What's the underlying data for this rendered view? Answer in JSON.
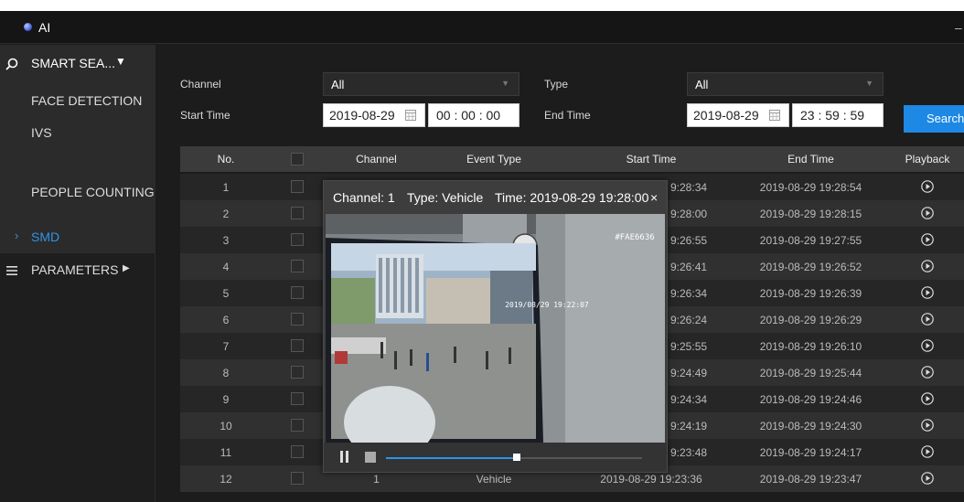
{
  "app": {
    "title": "AI",
    "minimize": "–"
  },
  "sidebar": {
    "smart_search": "SMART SEA...",
    "face_detection": "FACE DETECTION",
    "ivs": "IVS",
    "people_counting": "PEOPLE COUNTING",
    "smd": "SMD",
    "parameters": "PARAMETERS"
  },
  "filters": {
    "channel_label": "Channel",
    "channel_value": "All",
    "type_label": "Type",
    "type_value": "All",
    "start_label": "Start Time",
    "start_date": "2019-08-29",
    "start_time": "00 : 00 : 00",
    "end_label": "End Time",
    "end_date": "2019-08-29",
    "end_time": "23 : 59 : 59",
    "search_label": "Search"
  },
  "table": {
    "headers": {
      "no": "No.",
      "channel": "Channel",
      "event_type": "Event Type",
      "start": "Start Time",
      "end": "End Time",
      "playback": "Playback"
    },
    "rows": [
      {
        "no": "1",
        "start": "9:28:34",
        "end": "2019-08-29 19:28:54"
      },
      {
        "no": "2",
        "start": "9:28:00",
        "end": "2019-08-29 19:28:15"
      },
      {
        "no": "3",
        "start": "9:26:55",
        "end": "2019-08-29 19:27:55"
      },
      {
        "no": "4",
        "start": "9:26:41",
        "end": "2019-08-29 19:26:52"
      },
      {
        "no": "5",
        "start": "9:26:34",
        "end": "2019-08-29 19:26:39"
      },
      {
        "no": "6",
        "start": "9:26:24",
        "end": "2019-08-29 19:26:29"
      },
      {
        "no": "7",
        "start": "9:25:55",
        "end": "2019-08-29 19:26:10"
      },
      {
        "no": "8",
        "start": "9:24:49",
        "end": "2019-08-29 19:25:44"
      },
      {
        "no": "9",
        "start": "9:24:34",
        "end": "2019-08-29 19:24:46"
      },
      {
        "no": "10",
        "start": "9:24:19",
        "end": "2019-08-29 19:24:30"
      },
      {
        "no": "11",
        "start": "9:23:48",
        "end": "2019-08-29 19:24:17"
      },
      {
        "no": "12",
        "channel": "1",
        "event_type": "Vehicle",
        "start": "2019-08-29 19:23:36",
        "end": "2019-08-29 19:23:47"
      }
    ]
  },
  "popup": {
    "channel": "Channel: 1",
    "type": "Type: Vehicle",
    "time": "Time: 2019-08-29 19:28:00",
    "close": "×",
    "overlay_id": "#FAE6636",
    "overlay_timestamp": "2019/08/29 19:22:07",
    "progress": 0.51
  },
  "colors": {
    "accent": "#2e93e8",
    "search_button": "#1e88e5",
    "background": "#1c1c1c"
  }
}
